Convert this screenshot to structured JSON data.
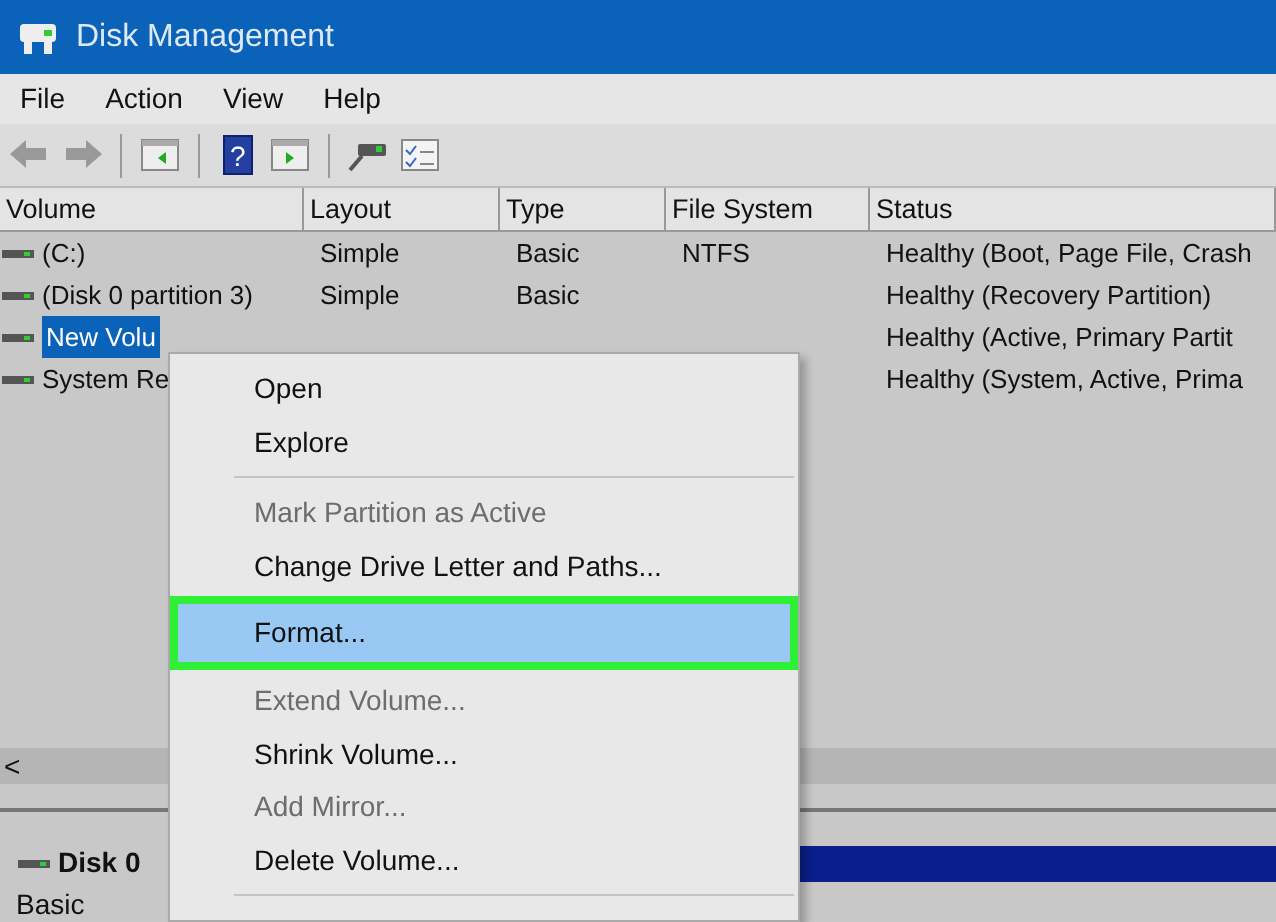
{
  "window": {
    "title": "Disk Management"
  },
  "menu_bar": [
    "File",
    "Action",
    "View",
    "Help"
  ],
  "toolbar": [
    {
      "kind": "back"
    },
    {
      "kind": "forward"
    },
    {
      "kind": "sep"
    },
    {
      "kind": "tree"
    },
    {
      "kind": "sep"
    },
    {
      "kind": "help",
      "label": "?"
    },
    {
      "kind": "pane"
    },
    {
      "kind": "sep"
    },
    {
      "kind": "connect"
    },
    {
      "kind": "props"
    }
  ],
  "table": {
    "columns": [
      "Volume",
      "Layout",
      "Type",
      "File System",
      "Status"
    ],
    "rows": [
      {
        "volume": "(C:)",
        "layout": "Simple",
        "type": "Basic",
        "file_system": "NTFS",
        "status": "Healthy (Boot, Page File, Crash",
        "selected": false
      },
      {
        "volume": "(Disk 0 partition 3)",
        "layout": "Simple",
        "type": "Basic",
        "status": "Healthy (Recovery Partition)",
        "selected": false
      },
      {
        "volume": "New Volu",
        "status": "Healthy (Active, Primary Partit",
        "selected": true
      },
      {
        "volume": "System Re",
        "status": "Healthy (System, Active, Prima",
        "selected": false
      }
    ]
  },
  "scrollbar_arrow": "<",
  "disk_panel": {
    "name": "Disk 0",
    "type": "Basic"
  },
  "context_menu": {
    "items": [
      {
        "kind": "item",
        "label": "Open",
        "disabled": false,
        "highlighted": false
      },
      {
        "kind": "item",
        "label": "Explore",
        "disabled": false,
        "highlighted": false
      },
      {
        "kind": "separator"
      },
      {
        "kind": "item",
        "label": "Mark Partition as Active",
        "disabled": true,
        "highlighted": false
      },
      {
        "kind": "item",
        "label": "Change Drive Letter and Paths...",
        "disabled": false,
        "highlighted": false
      },
      {
        "kind": "item",
        "label": "Format...",
        "disabled": false,
        "highlighted": true
      },
      {
        "kind": "item",
        "label": "Extend Volume...",
        "disabled": true,
        "highlighted": false
      },
      {
        "kind": "item",
        "label": "Shrink Volume...",
        "disabled": false,
        "highlighted": false
      },
      {
        "kind": "item",
        "label": "Add Mirror...",
        "disabled": true,
        "highlighted": false
      },
      {
        "kind": "item",
        "label": "Delete Volume...",
        "disabled": false,
        "highlighted": false
      },
      {
        "kind": "separator"
      }
    ]
  }
}
